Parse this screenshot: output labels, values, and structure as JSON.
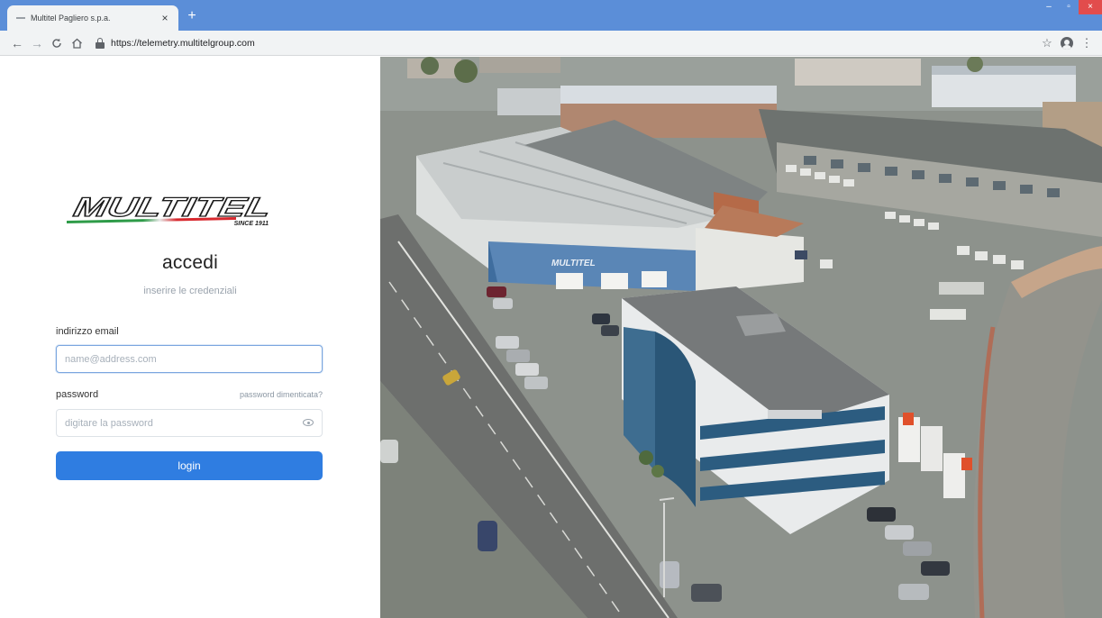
{
  "browser": {
    "tab_title": "Multitel Pagliero s.p.a.",
    "tab_close": "×",
    "new_tab": "+",
    "url": "https://telemetry.multitelgroup.com",
    "window_controls": {
      "minimize": "–",
      "restore": "▫",
      "close": "×"
    }
  },
  "logo": {
    "brand": "MULTITEL",
    "tagline": "SINCE 1911",
    "stripe_colors": [
      "#2e9b48",
      "#ffffff",
      "#d8292f"
    ]
  },
  "login": {
    "title": "accedi",
    "subtitle": "inserire le credenziali",
    "email_label": "indirizzo email",
    "email_placeholder": "name@address.com",
    "email_value": "",
    "password_label": "password",
    "forgot_password": "password dimenticata?",
    "password_placeholder": "digitare la password",
    "password_value": "",
    "login_button": "login"
  },
  "photo": {
    "building_sign": "MULTITEL"
  },
  "colors": {
    "accent": "#2f7de1",
    "tabbar": "#5b8ed8",
    "focus_border": "#7aa6df"
  }
}
